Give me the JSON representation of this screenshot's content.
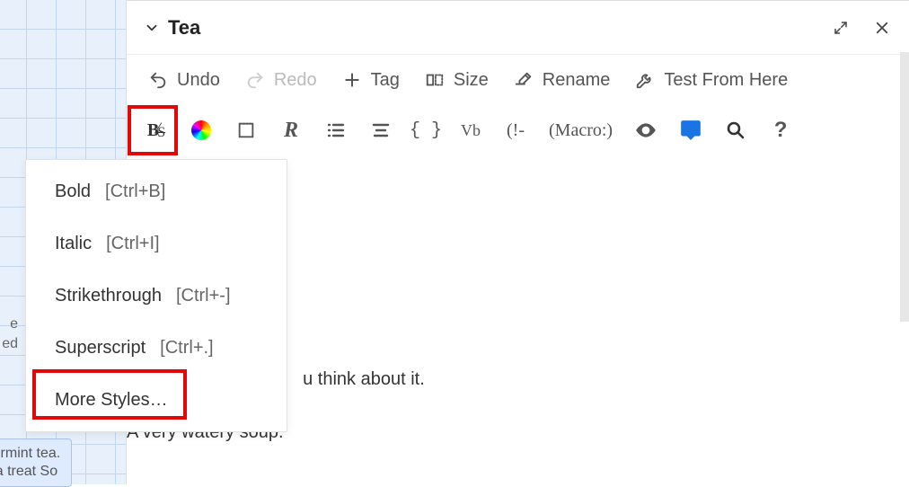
{
  "titlebar": {
    "title": "Tea"
  },
  "toolbar1": {
    "undo": "Undo",
    "redo": "Redo",
    "tag": "Tag",
    "size": "Size",
    "rename": "Rename",
    "test": "Test From Here"
  },
  "toolbar2": {
    "styles_name": "text-styles",
    "color_name": "color",
    "border_name": "border",
    "rotation_name": "rotation",
    "list_name": "numbered-list",
    "align_name": "align",
    "code_name": "code-braces",
    "var_label": "Vb",
    "cond_label": "(!-",
    "macro_label": "(Macro:)",
    "preview_name": "eye",
    "comment_name": "comment",
    "search_name": "search",
    "help_label": "?"
  },
  "styles_menu": {
    "items": [
      {
        "label": "Bold",
        "accel": "[Ctrl+B]"
      },
      {
        "label": "Italic",
        "accel": "[Ctrl+I]"
      },
      {
        "label": "Strikethrough",
        "accel": "[Ctrl+-]"
      },
      {
        "label": "Superscript",
        "accel": "[Ctrl+.]"
      },
      {
        "label": "More Styles…",
        "accel": ""
      }
    ]
  },
  "body": {
    "line1_tail": "u think about it.",
    "line2": "A very watery soup."
  },
  "left_snippets": {
    "s1a": "e",
    "s1b": "ed",
    "s2a": "permint tea.",
    "s2b": "t a treat  So"
  }
}
